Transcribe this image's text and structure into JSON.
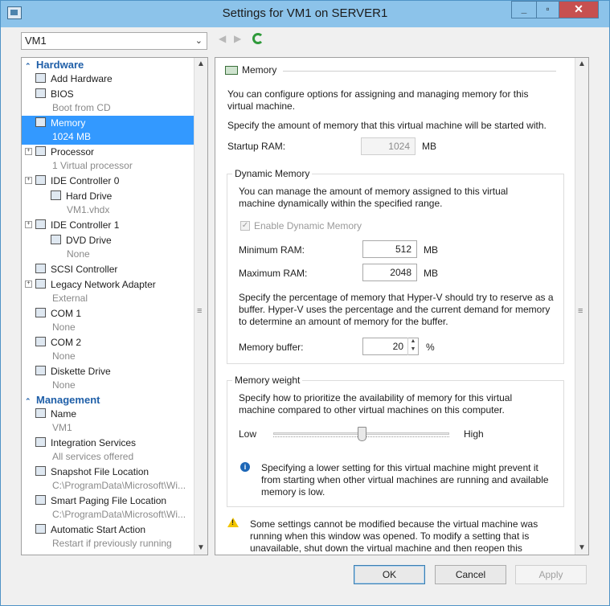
{
  "window": {
    "title": "Settings for VM1 on SERVER1"
  },
  "vm_selector": {
    "value": "VM1"
  },
  "nav": {
    "back": "◀",
    "forward": "▶"
  },
  "sidebar": {
    "hardware_title": "Hardware",
    "hardware_items": [
      {
        "name": "add-hardware",
        "label": "Add Hardware",
        "sub": ""
      },
      {
        "name": "bios",
        "label": "BIOS",
        "sub": "Boot from CD"
      },
      {
        "name": "memory",
        "label": "Memory",
        "sub": "1024 MB",
        "selected": true
      },
      {
        "name": "processor",
        "label": "Processor",
        "sub": "1 Virtual processor"
      },
      {
        "name": "ide-controller-0",
        "label": "IDE Controller 0",
        "sub": ""
      },
      {
        "name": "hard-drive",
        "label": "Hard Drive",
        "sub": "VM1.vhdx"
      },
      {
        "name": "ide-controller-1",
        "label": "IDE Controller 1",
        "sub": ""
      },
      {
        "name": "dvd-drive",
        "label": "DVD Drive",
        "sub": "None"
      },
      {
        "name": "scsi-controller",
        "label": "SCSI Controller",
        "sub": ""
      },
      {
        "name": "legacy-network-adapter",
        "label": "Legacy Network Adapter",
        "sub": "External"
      },
      {
        "name": "com-1",
        "label": "COM 1",
        "sub": "None"
      },
      {
        "name": "com-2",
        "label": "COM 2",
        "sub": "None"
      },
      {
        "name": "diskette-drive",
        "label": "Diskette Drive",
        "sub": "None"
      }
    ],
    "management_title": "Management",
    "management_items": [
      {
        "name": "name",
        "label": "Name",
        "sub": "VM1"
      },
      {
        "name": "integration-services",
        "label": "Integration Services",
        "sub": "All services offered"
      },
      {
        "name": "snapshot-file-location",
        "label": "Snapshot File Location",
        "sub": "C:\\ProgramData\\Microsoft\\Wi..."
      },
      {
        "name": "smart-paging-file-location",
        "label": "Smart Paging File Location",
        "sub": "C:\\ProgramData\\Microsoft\\Wi..."
      },
      {
        "name": "automatic-start-action",
        "label": "Automatic Start Action",
        "sub": "Restart if previously running"
      }
    ]
  },
  "memory": {
    "heading": "Memory",
    "intro": "You can configure options for assigning and managing memory for this virtual machine.",
    "startup_desc": "Specify the amount of memory that this virtual machine will be started with.",
    "startup_label": "Startup RAM:",
    "startup_value": "1024",
    "unit_mb": "MB",
    "dynamic": {
      "title": "Dynamic Memory",
      "desc": "You can manage the amount of memory assigned to this virtual machine dynamically within the specified range.",
      "enable_label": "Enable Dynamic Memory",
      "enabled": true,
      "min_label": "Minimum RAM:",
      "min_value": "512",
      "max_label": "Maximum RAM:",
      "max_value": "2048",
      "buffer_desc": "Specify the percentage of memory that Hyper-V should try to reserve as a buffer. Hyper-V uses the percentage and the current demand for memory to determine an amount of memory for the buffer.",
      "buffer_label": "Memory buffer:",
      "buffer_value": "20",
      "buffer_unit": "%"
    },
    "weight": {
      "title": "Memory weight",
      "desc": "Specify how to prioritize the availability of memory for this virtual machine compared to other virtual machines on this computer.",
      "low": "Low",
      "high": "High",
      "level": 0.5,
      "info": "Specifying a lower setting for this virtual machine might prevent it from starting when other virtual machines are running and available memory is low."
    },
    "warning": "Some settings cannot be modified because the virtual machine was running when this window was opened. To modify a setting that is unavailable, shut down the virtual machine and then reopen this"
  },
  "buttons": {
    "ok": "OK",
    "cancel": "Cancel",
    "apply": "Apply"
  }
}
